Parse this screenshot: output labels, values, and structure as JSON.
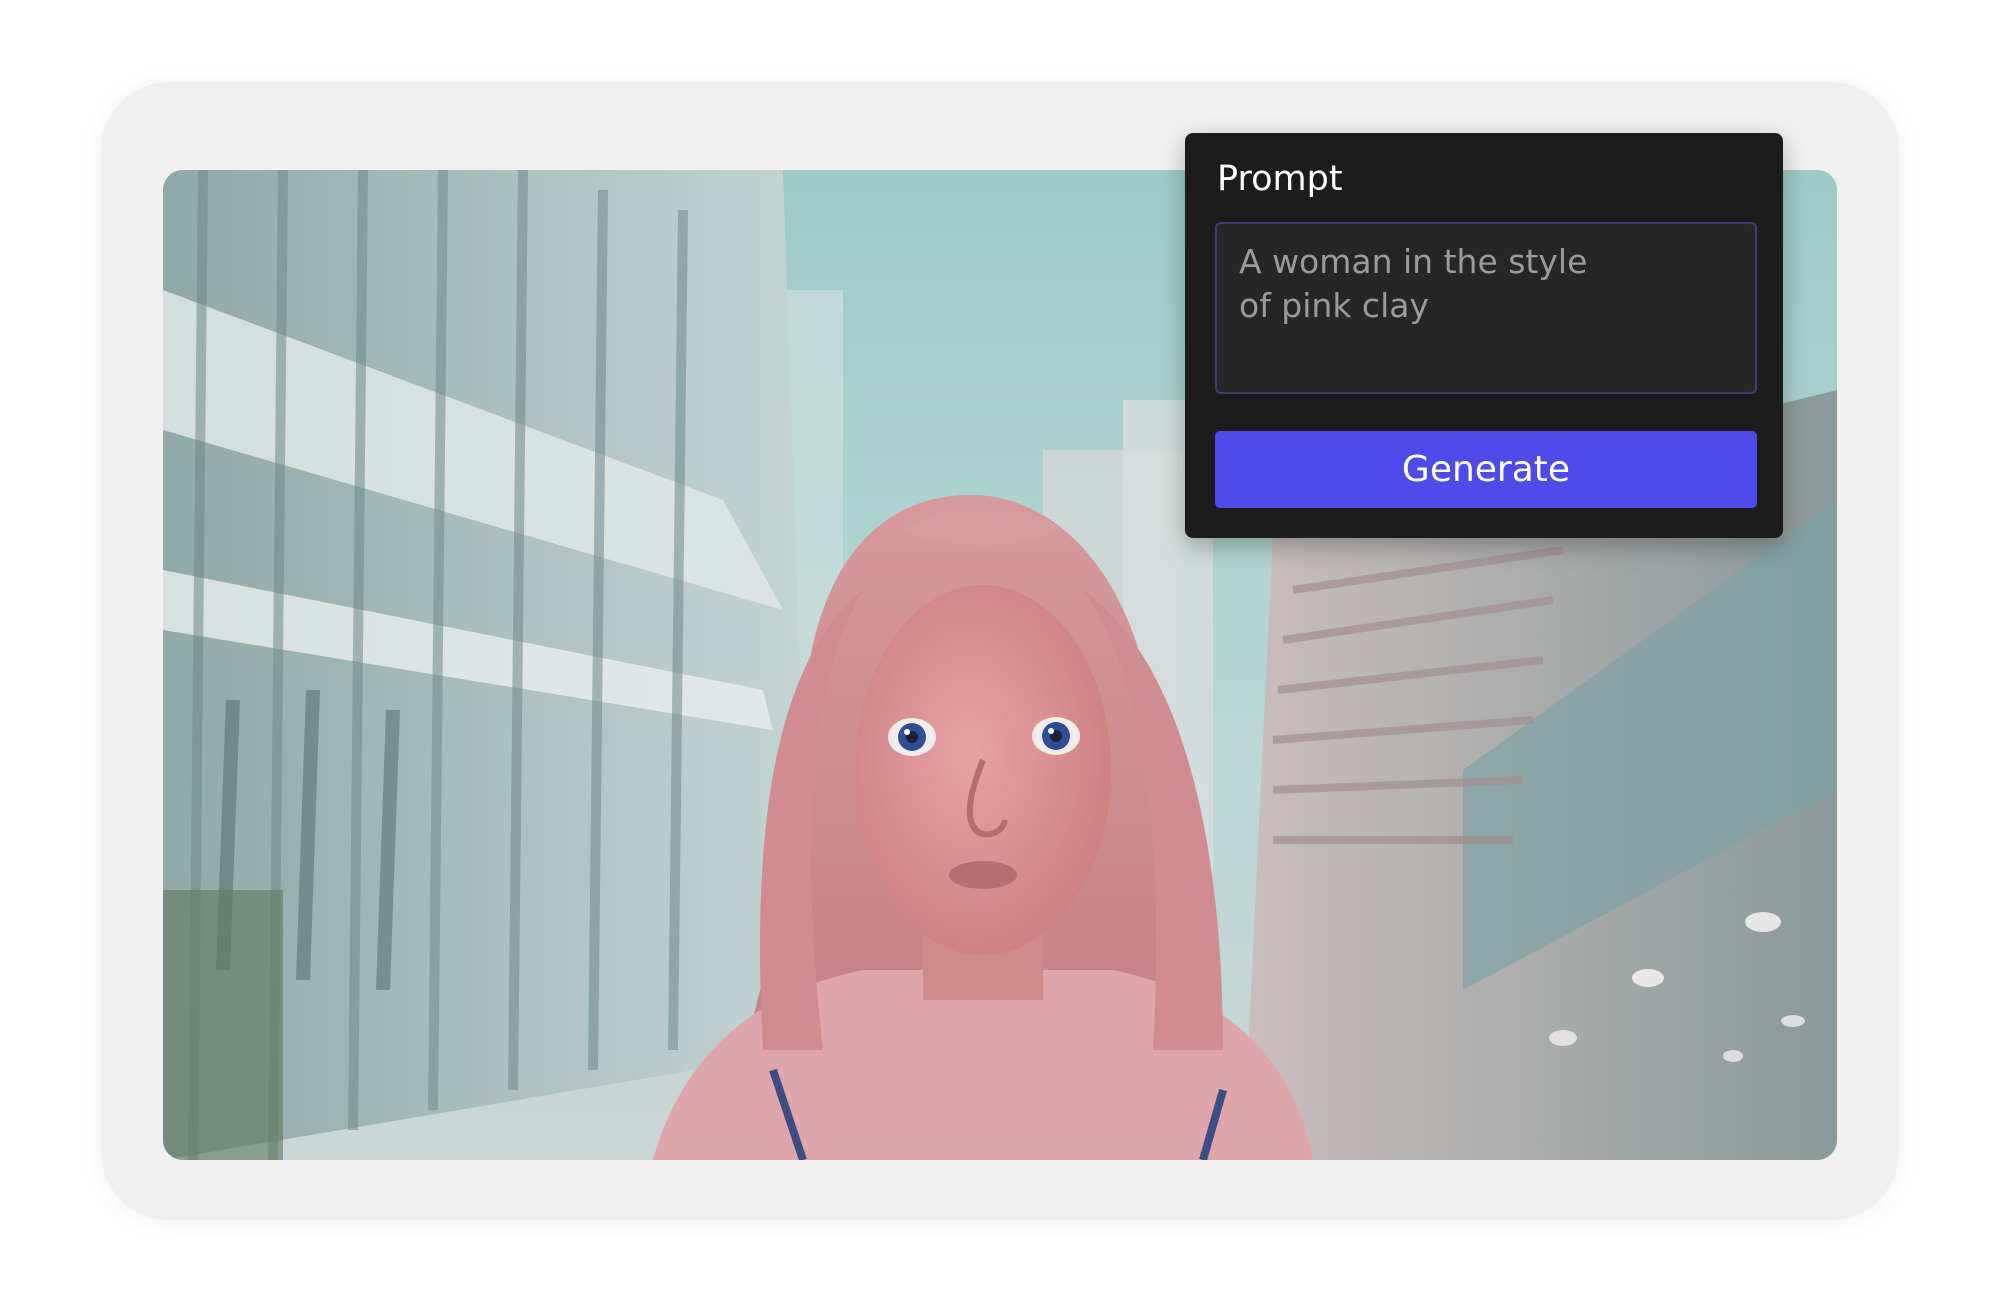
{
  "prompt_panel": {
    "title": "Prompt",
    "input_value": "A woman in the style\nof pink clay",
    "generate_label": "Generate",
    "accent_color": "#4e4ce8"
  },
  "generated_image": {
    "subject": "clay-style woman with long pink hair in a city street"
  }
}
